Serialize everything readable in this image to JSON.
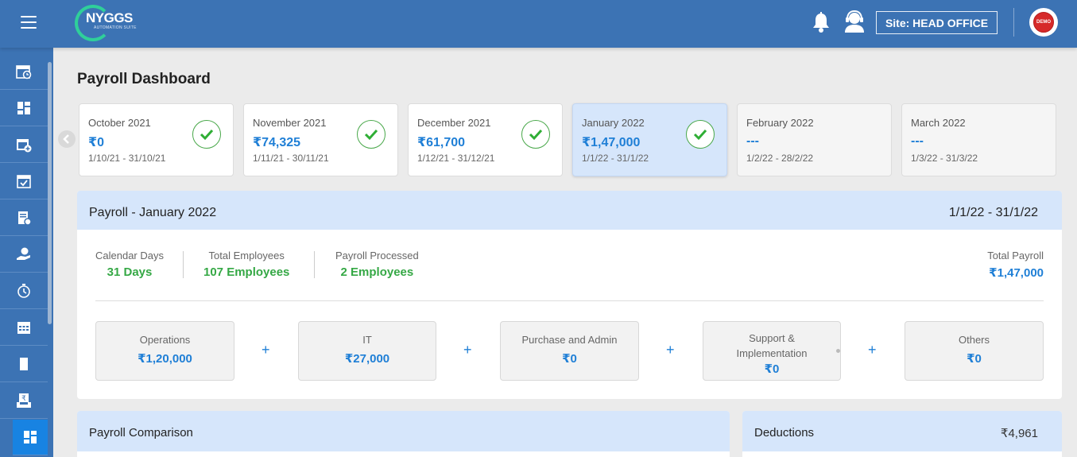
{
  "header": {
    "brand": "NYGGS",
    "brand_tagline": "AUTOMATION SUITE",
    "site_label": "Site: HEAD OFFICE",
    "avatar_text": "DEMO"
  },
  "sidebar": {
    "items": [
      {
        "icon": "calendar-clock-icon"
      },
      {
        "icon": "dashboard-grid-icon"
      },
      {
        "icon": "calendar-add-icon"
      },
      {
        "icon": "calendar-check-icon"
      },
      {
        "icon": "document-settings-icon"
      },
      {
        "icon": "hand-money-icon"
      },
      {
        "icon": "timer-icon"
      },
      {
        "icon": "calendar-grid-icon"
      },
      {
        "icon": "document-icon"
      },
      {
        "icon": "rupee-tray-icon"
      },
      {
        "icon": "dashboard-grid-icon",
        "active": true
      }
    ]
  },
  "page": {
    "title": "Payroll Dashboard"
  },
  "months": [
    {
      "label": "October 2021",
      "amount": "₹0",
      "range": "1/10/21 - 31/10/21",
      "processed": true
    },
    {
      "label": "November 2021",
      "amount": "₹74,325",
      "range": "1/11/21 - 30/11/21",
      "processed": true
    },
    {
      "label": "December 2021",
      "amount": "₹61,700",
      "range": "1/12/21 - 31/12/21",
      "processed": true
    },
    {
      "label": "January 2022",
      "amount": "₹1,47,000",
      "range": "1/1/22 - 31/1/22",
      "processed": true,
      "selected": true
    },
    {
      "label": "February 2022",
      "amount": "---",
      "range": "1/2/22 - 28/2/22",
      "processed": false
    },
    {
      "label": "March 2022",
      "amount": "---",
      "range": "1/3/22 - 31/3/22",
      "processed": false
    }
  ],
  "payroll": {
    "title": "Payroll - January 2022",
    "range": "1/1/22 - 31/1/22",
    "stats": [
      {
        "label": "Calendar Days",
        "value": "31 Days"
      },
      {
        "label": "Total Employees",
        "value": "107 Employees"
      },
      {
        "label": "Payroll Processed",
        "value": "2 Employees"
      }
    ],
    "total_label": "Total Payroll",
    "total_value": "₹1,47,000",
    "departments": [
      {
        "label": "Operations",
        "value": "₹1,20,000"
      },
      {
        "label": "IT",
        "value": "₹27,000"
      },
      {
        "label": "Purchase and Admin",
        "value": "₹0"
      },
      {
        "label": "Support & Implementation",
        "value": "₹0"
      },
      {
        "label": "Others",
        "value": "₹0"
      }
    ],
    "plus": "+"
  },
  "comparison": {
    "title": "Payroll Comparison"
  },
  "deductions": {
    "title": "Deductions",
    "value": "₹4,961"
  },
  "colors": {
    "header_bg": "#3c73b4",
    "accent_blue": "#1f7fd6",
    "success_green": "#35a845",
    "selected_card_bg": "#d6e6fb"
  }
}
